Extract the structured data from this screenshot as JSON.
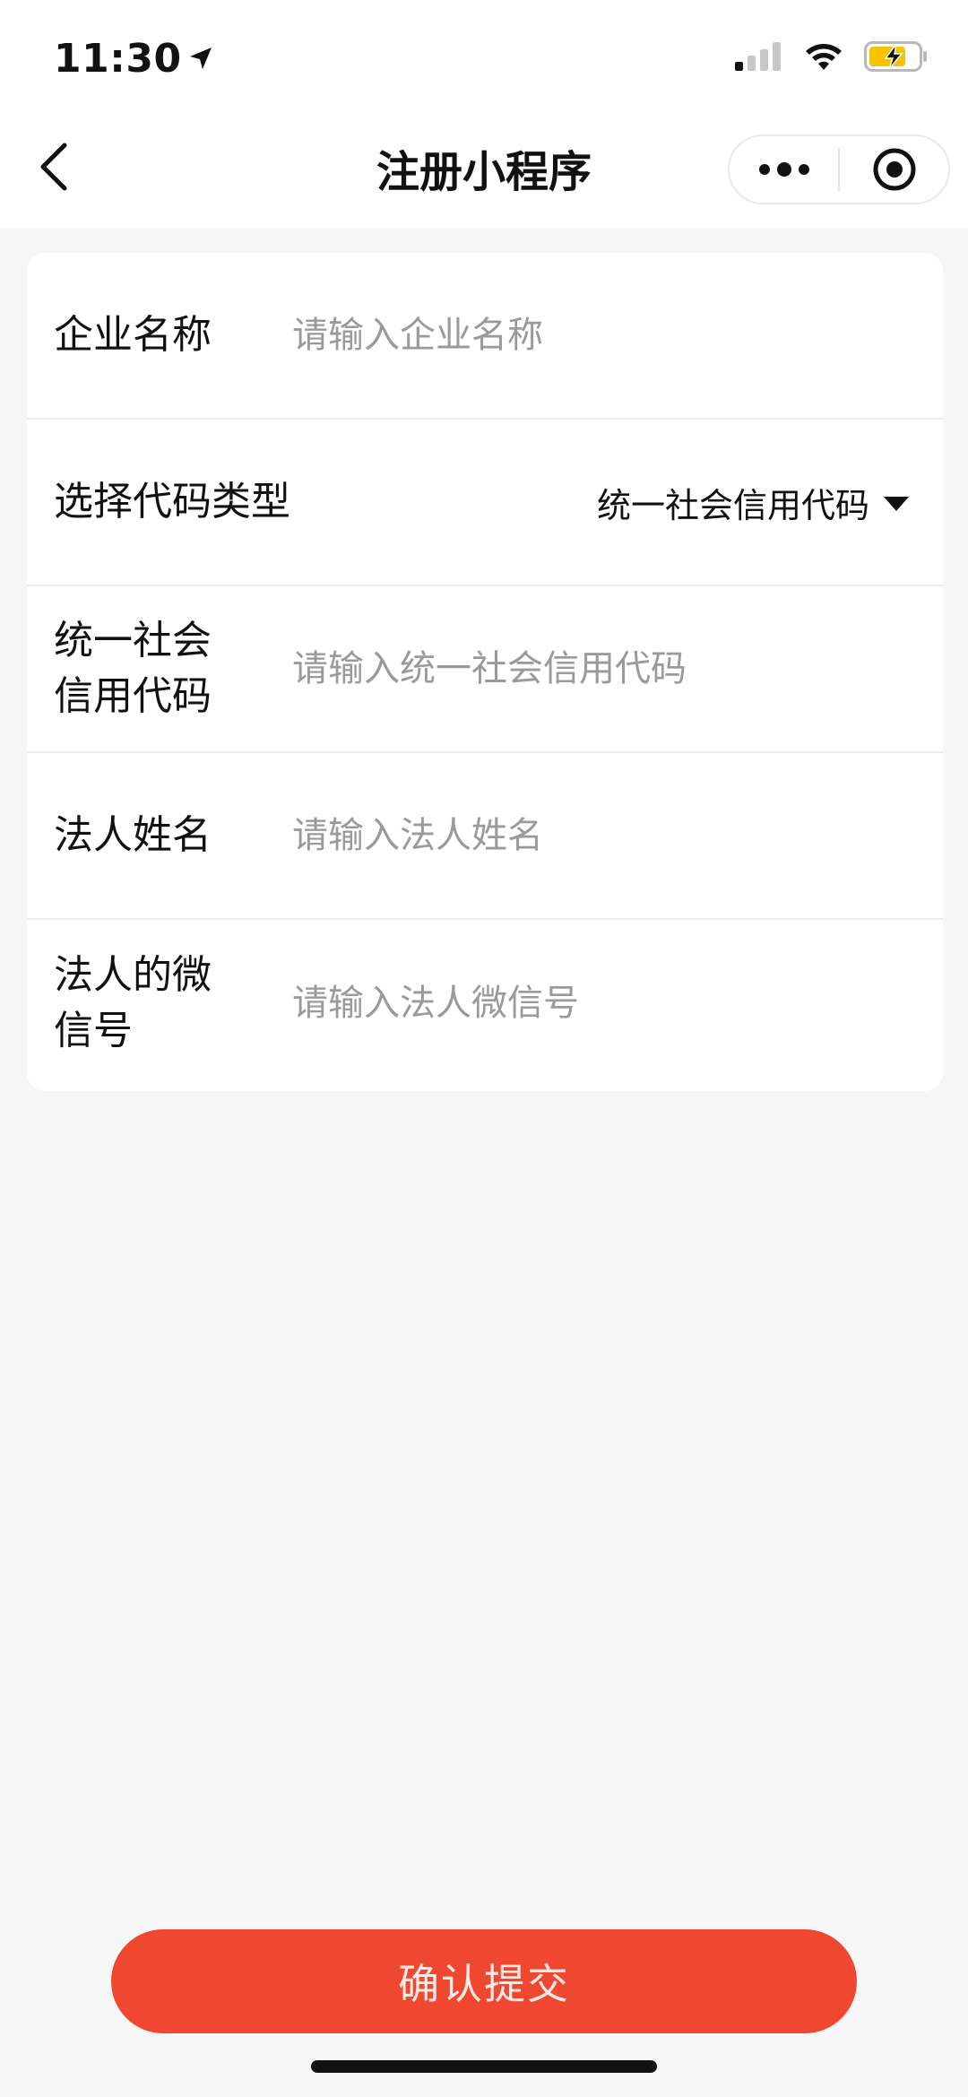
{
  "status_bar": {
    "time": "11:30",
    "colors": {
      "battery_fill": "#f5c400"
    },
    "icons": [
      "location-arrow-icon",
      "cellular-signal-icon",
      "wifi-icon",
      "battery-charging-icon"
    ]
  },
  "nav": {
    "title": "注册小程序",
    "icons": [
      "back-arrow-icon",
      "more-dots-icon",
      "close-target-icon"
    ]
  },
  "form": {
    "fields": [
      {
        "label": "企业名称",
        "placeholder": "请输入企业名称",
        "value": ""
      },
      {
        "label": "选择代码类型",
        "selected": "统一社会信用代码"
      },
      {
        "label_line1": "统一社会",
        "label_line2": "信用代码",
        "placeholder": "请输入统一社会信用代码",
        "value": ""
      },
      {
        "label": "法人姓名",
        "placeholder": "请输入法人姓名",
        "value": ""
      },
      {
        "label_line1": "法人的微",
        "label_line2": "信号",
        "placeholder": "请输入法人微信号",
        "value": ""
      }
    ]
  },
  "submit": {
    "label": "确认提交",
    "color": "#f04730"
  }
}
